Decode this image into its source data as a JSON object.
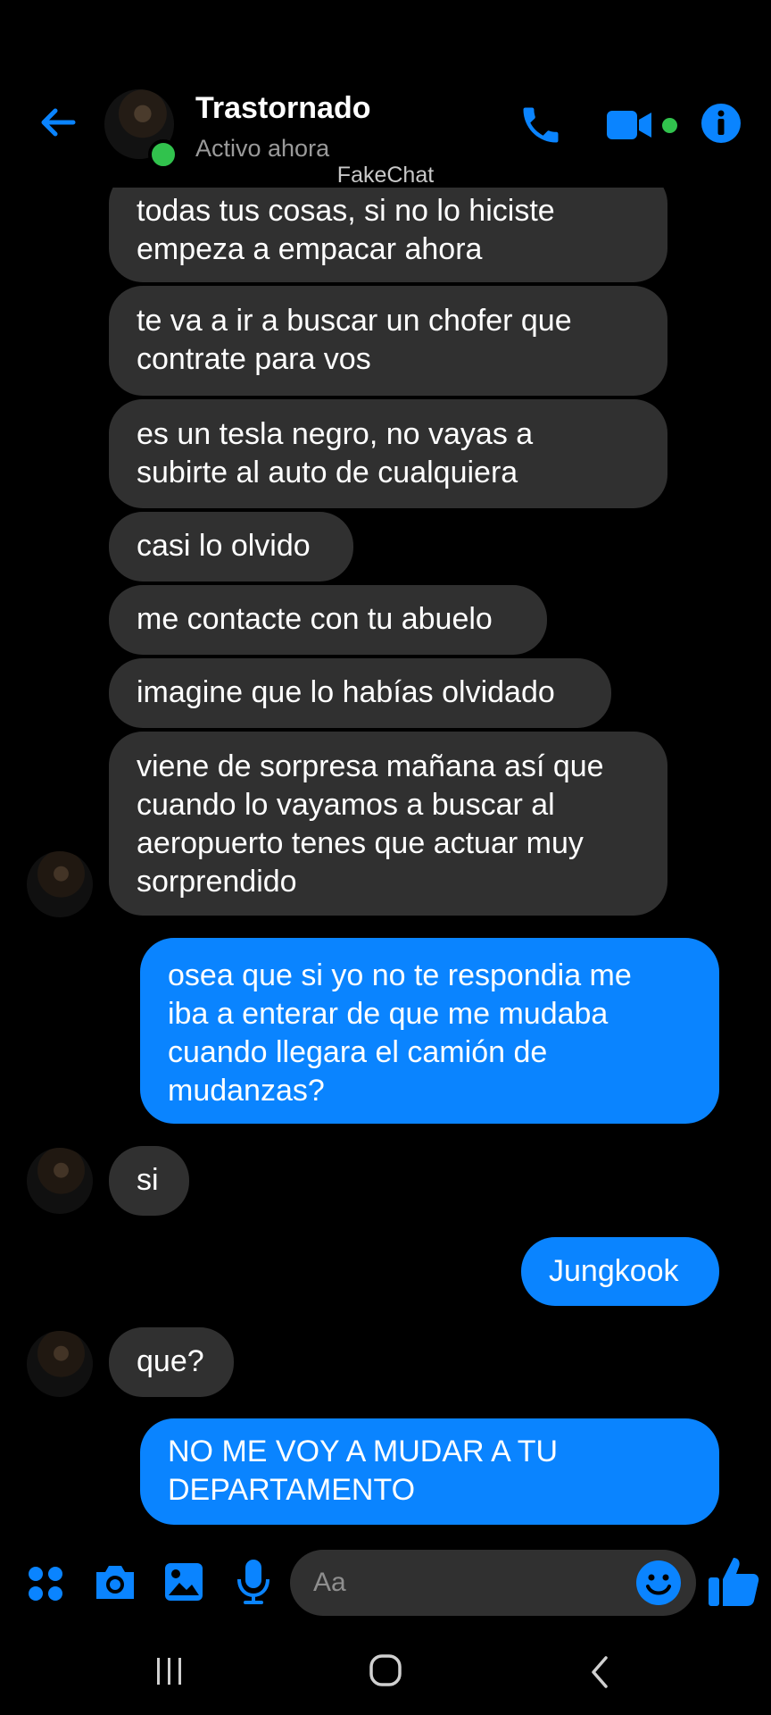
{
  "header": {
    "contact_name": "Trastornado",
    "status": "Activo ahora",
    "watermark": "FakeChat"
  },
  "messages": [
    {
      "from": "contact",
      "text": "todas tus cosas, si no lo hiciste\nempeza a empacar ahora"
    },
    {
      "from": "contact",
      "text": "te va a ir a buscar un chofer que\ncontrate para vos"
    },
    {
      "from": "contact",
      "text": " es un tesla negro, no vayas a\nsubirte al auto de cualquiera"
    },
    {
      "from": "contact",
      "text": "casi lo olvido"
    },
    {
      "from": "contact",
      "text": "me contacte con tu abuelo"
    },
    {
      "from": "contact",
      "text": "imagine que lo habías olvidado"
    },
    {
      "from": "contact",
      "text": "viene de sorpresa mañana así que\ncuando lo vayamos a buscar al\naeropuerto tenes que actuar muy\nsorprendido"
    },
    {
      "from": "me",
      "text": "osea que si yo no te respondia me\niba a enterar de que me mudaba\ncuando llegara el camión de\nmudanzas?"
    },
    {
      "from": "contact",
      "text": "si"
    },
    {
      "from": "me",
      "text": "Jungkook"
    },
    {
      "from": "contact",
      "text": "que?"
    },
    {
      "from": "me",
      "text": "NO ME VOY A MUDAR A TU\nDEPARTAMENTO"
    }
  ],
  "composer": {
    "placeholder": "Aa"
  },
  "colors": {
    "accent": "#0a84ff",
    "incoming_bubble": "#303030",
    "online": "#31c24d",
    "background": "#000000"
  },
  "icons": [
    "back-arrow-icon",
    "phone-icon",
    "video-camera-icon",
    "info-icon",
    "apps-icon",
    "camera-icon",
    "image-icon",
    "microphone-icon",
    "emoji-icon",
    "like-icon",
    "recent-apps-icon",
    "home-icon",
    "nav-back-icon"
  ]
}
